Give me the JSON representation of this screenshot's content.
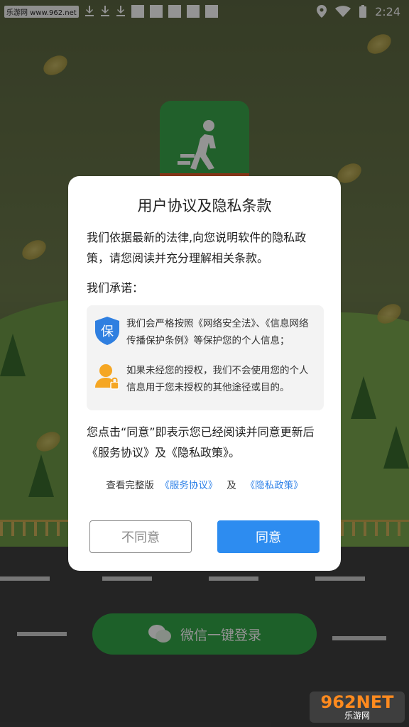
{
  "status_bar": {
    "watermark": "乐游网 www.962.net",
    "time": "2:24",
    "download_icon_count": 3,
    "notification_square_count": 5
  },
  "background": {
    "login_button_label": "微信一键登录",
    "brand_watermark_top": "962NET",
    "brand_watermark_bottom": "乐游网"
  },
  "dialog": {
    "title": "用户协议及隐私条款",
    "intro": "我们依据最新的法律,向您说明软件的隐私政策，请您阅读并充分理解相关条款。",
    "promise_heading": "我们承诺：",
    "promises": [
      {
        "icon": "shield-icon",
        "icon_glyph": "保",
        "text": "我们会严格按照《网络安全法》、《信息网络传播保护条例》等保护您的个人信息；"
      },
      {
        "icon": "user-lock-icon",
        "text": "如果未经您的授权，我们不会使用您的个人信息用于您未授权的其他途径或目的。"
      }
    ],
    "consent": "您点击“同意”即表示您已经阅读并同意更新后《服务协议》及《隐私政策》。",
    "links": {
      "prefix": "查看完整版",
      "service_agreement": "《服务协议》",
      "conjunction": "及",
      "privacy_policy": "《隐私政策》"
    },
    "buttons": {
      "decline": "不同意",
      "agree": "同意"
    }
  },
  "colors": {
    "accent_blue": "#2d8cf0",
    "link_blue": "#2f82e8",
    "icon_orange": "#f5a623",
    "brand_green": "#33a548"
  }
}
